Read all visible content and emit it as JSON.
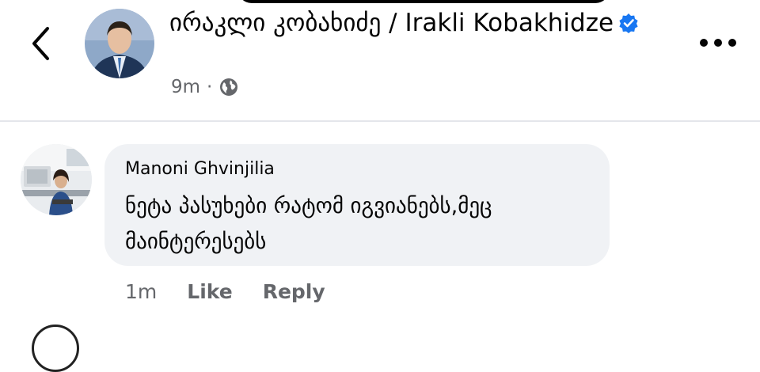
{
  "post": {
    "author_name": "ირაკლი კობახიძე / Irakli Kobakhidze",
    "time": "9m",
    "separator": "·",
    "audience_icon": "globe-icon",
    "verified_icon": "verified-badge-icon"
  },
  "comment": {
    "commenter_name": "Manoni Ghvinjilia",
    "text": "ნეტა პასუხები რატომ იგვიანებს,მეც მაინტერესებს",
    "time": "1m",
    "like_label": "Like",
    "reply_label": "Reply"
  },
  "colors": {
    "verified": "#1877f2",
    "muted_text": "#65676b",
    "bubble_bg": "#f0f2f5",
    "divider": "#e4e6eb"
  }
}
